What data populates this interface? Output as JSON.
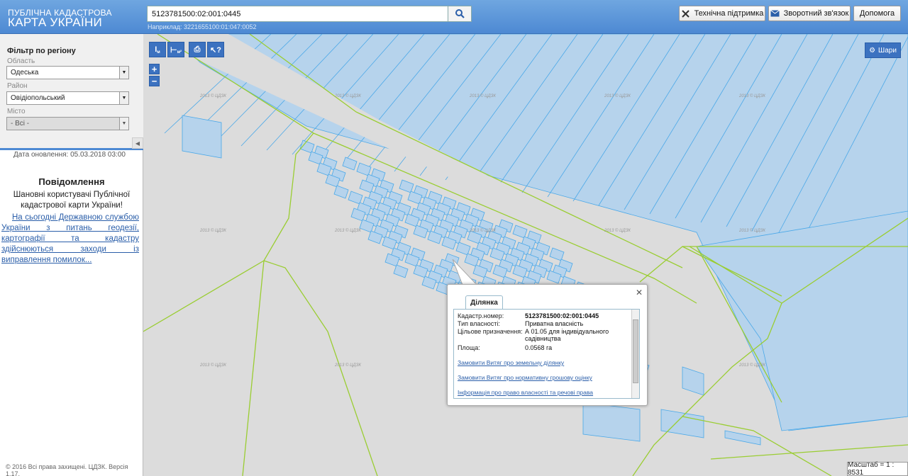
{
  "header": {
    "logo_small": "ПУБЛІЧНА КАДАСТРОВА",
    "logo_big": "КАРТА УКРАЇНИ",
    "search_value": "5123781500:02:001:0445",
    "search_hint": "Наприклад: 3221655100:01:047:0052",
    "support_label": "Технічна підтримка",
    "feedback_label": "Зворотний зв'язок",
    "help_label": "Допомога"
  },
  "filter": {
    "title": "Фільтр по регіону",
    "region_label": "Область",
    "region_value": "Одеська",
    "district_label": "Район",
    "district_value": "Овідіопольський",
    "city_label": "Місто",
    "city_value": "- Всі -"
  },
  "sidebar": {
    "update_date": "Дата оновлення: 05.03.2018 03:00",
    "notice_title": "Повідомлення",
    "notice_text": "Шановні користувачі Публічної кадастрової карти України!",
    "notice_link": "На сьогодні Державною службою України з питань геодезії, картографії та кадастру здійснюються заходи із виправлення помилок...",
    "copyright": "© 2016 Всі права захищені. ЦДЗК. Версія 1.17."
  },
  "toolbar": {
    "measure_line": "I",
    "measure_line_sub": "м",
    "measure_area": "⊢",
    "measure_area_sub": "м²",
    "print": "⎙",
    "identify": "↖?",
    "zoom_in": "+",
    "zoom_out": "−",
    "layers_label": "Шари"
  },
  "popup": {
    "tab": "Ділянка",
    "close": "✕",
    "rows": [
      {
        "key": "Кадастр.номер:",
        "value": "5123781500:02:001:0445"
      },
      {
        "key": "Тип власності:",
        "value": "Приватна власність"
      },
      {
        "key": "Цільове призначення:",
        "value": "А 01.05 для індивідуального садівництва"
      },
      {
        "key": "Площа:",
        "value": "0.0568 га"
      }
    ],
    "links": [
      "Замовити Витяг про земельну ділянку",
      "Замовити Витяг про нормативну грошову оцінку",
      "Інформація про право власності та речові права"
    ]
  },
  "map": {
    "watermark": "2013 © ЦДЗК",
    "scale": "Масштаб = 1 : 8531"
  },
  "colors": {
    "header": "#5b96da",
    "parcel_fill": "#b6d3ec",
    "parcel_stroke": "#4aa8e8",
    "boundary": "#9acd32",
    "map_bg": "#dcdcdc"
  }
}
